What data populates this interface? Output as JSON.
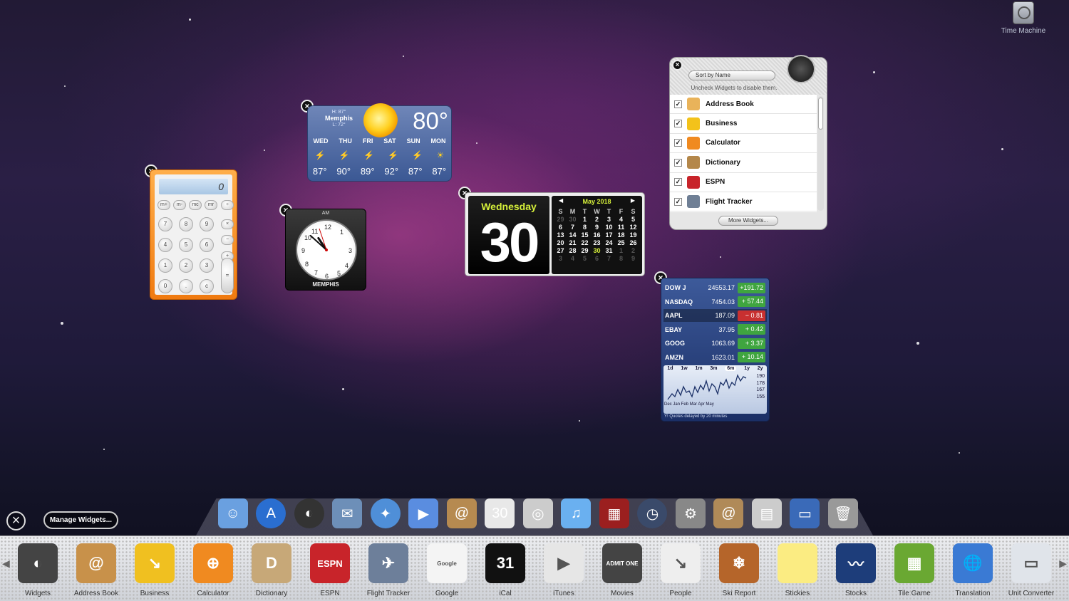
{
  "time_machine": {
    "label": "Time Machine"
  },
  "calculator": {
    "display": "0",
    "row0": [
      "m+",
      "m-",
      "mc",
      "mr",
      "÷"
    ],
    "row1": [
      "7",
      "8",
      "9",
      "×"
    ],
    "row2": [
      "4",
      "5",
      "6",
      "−"
    ],
    "row3": [
      "1",
      "2",
      "3",
      "+"
    ],
    "row4": [
      "0",
      ".",
      "c",
      "="
    ]
  },
  "weather": {
    "high": "H: 87°",
    "city": "Memphis",
    "low": "L: 72°",
    "current": "80°",
    "days": [
      "WED",
      "THU",
      "FRI",
      "SAT",
      "SUN",
      "MON"
    ],
    "temps": [
      "87°",
      "90°",
      "89°",
      "92°",
      "87°",
      "87°"
    ]
  },
  "clock": {
    "ampm": "AM",
    "city": "MEMPHIS",
    "hour": 10,
    "minute": 52
  },
  "ical": {
    "day_name": "Wednesday",
    "day_num": "30",
    "month": "May 2018",
    "weekday_headers": [
      "S",
      "M",
      "T",
      "W",
      "T",
      "F",
      "S"
    ],
    "weeks": [
      [
        "29",
        "30",
        "1",
        "2",
        "3",
        "4",
        "5"
      ],
      [
        "6",
        "7",
        "8",
        "9",
        "10",
        "11",
        "12"
      ],
      [
        "13",
        "14",
        "15",
        "16",
        "17",
        "18",
        "19"
      ],
      [
        "20",
        "21",
        "22",
        "23",
        "24",
        "25",
        "26"
      ],
      [
        "27",
        "28",
        "29",
        "30",
        "31",
        "1",
        "2"
      ],
      [
        "3",
        "4",
        "5",
        "6",
        "7",
        "8",
        "9"
      ]
    ],
    "today": "30"
  },
  "stocks": {
    "rows": [
      {
        "symbol": "DOW J",
        "price": "24553.17",
        "change": "+191.72",
        "dir": "up"
      },
      {
        "symbol": "NASDAQ",
        "price": "7454.03",
        "change": "+ 57.44",
        "dir": "up"
      },
      {
        "symbol": "AAPL",
        "price": "187.09",
        "change": "− 0.81",
        "dir": "down"
      },
      {
        "symbol": "EBAY",
        "price": "37.95",
        "change": "+ 0.42",
        "dir": "up"
      },
      {
        "symbol": "GOOG",
        "price": "1063.69",
        "change": "+ 3.37",
        "dir": "up"
      },
      {
        "symbol": "AMZN",
        "price": "1623.01",
        "change": "+ 10.14",
        "dir": "up"
      }
    ],
    "ranges": [
      "1d",
      "1w",
      "1m",
      "3m",
      "6m",
      "1y",
      "2y"
    ],
    "selected_range": "6m",
    "y_axis": [
      "190",
      "178",
      "167",
      "155"
    ],
    "x_axis": "Dec Jan  Feb Mar  Apr  May",
    "delay_note": "Quotes delayed by 20 minutes"
  },
  "widget_manager": {
    "sort": "Sort by Name",
    "hint": "Uncheck Widgets to disable them.",
    "items": [
      {
        "label": "Address Book",
        "color": "#e9b35a"
      },
      {
        "label": "Business",
        "color": "#f3c21a"
      },
      {
        "label": "Calculator",
        "color": "#f08a20"
      },
      {
        "label": "Dictionary",
        "color": "#b4874a"
      },
      {
        "label": "ESPN",
        "color": "#c8242a"
      },
      {
        "label": "Flight Tracker",
        "color": "#6f7f95"
      }
    ],
    "more": "More Widgets..."
  },
  "manage_widgets": "Manage Widgets...",
  "widget_bar": [
    {
      "label": "Widgets",
      "color": "#444",
      "glyph": "◐"
    },
    {
      "label": "Address Book",
      "color": "#c8914a",
      "glyph": "@"
    },
    {
      "label": "Business",
      "color": "#f0c020",
      "glyph": "↘"
    },
    {
      "label": "Calculator",
      "color": "#f08a20",
      "glyph": "⊕"
    },
    {
      "label": "Dictionary",
      "color": "#c7a878",
      "glyph": "D"
    },
    {
      "label": "ESPN",
      "color": "#c8242a",
      "glyph": "ESPN"
    },
    {
      "label": "Flight Tracker",
      "color": "#6d7f9a",
      "glyph": "✈"
    },
    {
      "label": "Google",
      "color": "#f4f4f4",
      "glyph": "Google"
    },
    {
      "label": "iCal",
      "color": "#111",
      "glyph": "31"
    },
    {
      "label": "iTunes",
      "color": "#e6e6e6",
      "glyph": "▶"
    },
    {
      "label": "Movies",
      "color": "#444",
      "glyph": "ADMIT ONE"
    },
    {
      "label": "People",
      "color": "#eee",
      "glyph": "↘"
    },
    {
      "label": "Ski Report",
      "color": "#b5652a",
      "glyph": "❄"
    },
    {
      "label": "Stickies",
      "color": "#fbec82",
      "glyph": ""
    },
    {
      "label": "Stocks",
      "color": "#1d3d7a",
      "glyph": "〰"
    },
    {
      "label": "Tile Game",
      "color": "#6aa832",
      "glyph": "▦"
    },
    {
      "label": "Translation",
      "color": "#3a7ad4",
      "glyph": "🌐"
    },
    {
      "label": "Unit Converter",
      "color": "#e0e4ea",
      "glyph": "▭"
    }
  ],
  "dock_icons": [
    {
      "name": "finder-icon",
      "color": "#6aa0e0",
      "glyph": "☺"
    },
    {
      "name": "app-store-icon",
      "color": "#2a6ed0",
      "glyph": "A"
    },
    {
      "name": "dashboard-icon",
      "color": "#333",
      "glyph": "◐"
    },
    {
      "name": "mail-icon",
      "color": "#6d8fb8",
      "glyph": "✉"
    },
    {
      "name": "safari-icon",
      "color": "#4f8fd8",
      "glyph": "✦"
    },
    {
      "name": "ichat-icon",
      "color": "#5a8de0",
      "glyph": "▶"
    },
    {
      "name": "address-book-icon",
      "color": "#b68a50",
      "glyph": "@"
    },
    {
      "name": "ical-icon",
      "color": "#e8e8e8",
      "glyph": "30"
    },
    {
      "name": "preview-icon",
      "color": "#ccc",
      "glyph": "◎"
    },
    {
      "name": "itunes-icon",
      "color": "#6ab0f0",
      "glyph": "♫"
    },
    {
      "name": "photo-booth-icon",
      "color": "#9b1f1f",
      "glyph": "▦"
    },
    {
      "name": "time-machine-icon",
      "color": "#3a4a6a",
      "glyph": "◷"
    },
    {
      "name": "system-preferences-icon",
      "color": "#888",
      "glyph": "⚙"
    },
    {
      "name": "applications-stack-icon",
      "color": "#b08a58",
      "glyph": "@"
    },
    {
      "name": "documents-stack-icon",
      "color": "#ccc",
      "glyph": "▤"
    },
    {
      "name": "desktop-stack-icon",
      "color": "#3a6ab8",
      "glyph": "▭"
    },
    {
      "name": "trash-icon",
      "color": "#999",
      "glyph": "🗑"
    }
  ]
}
